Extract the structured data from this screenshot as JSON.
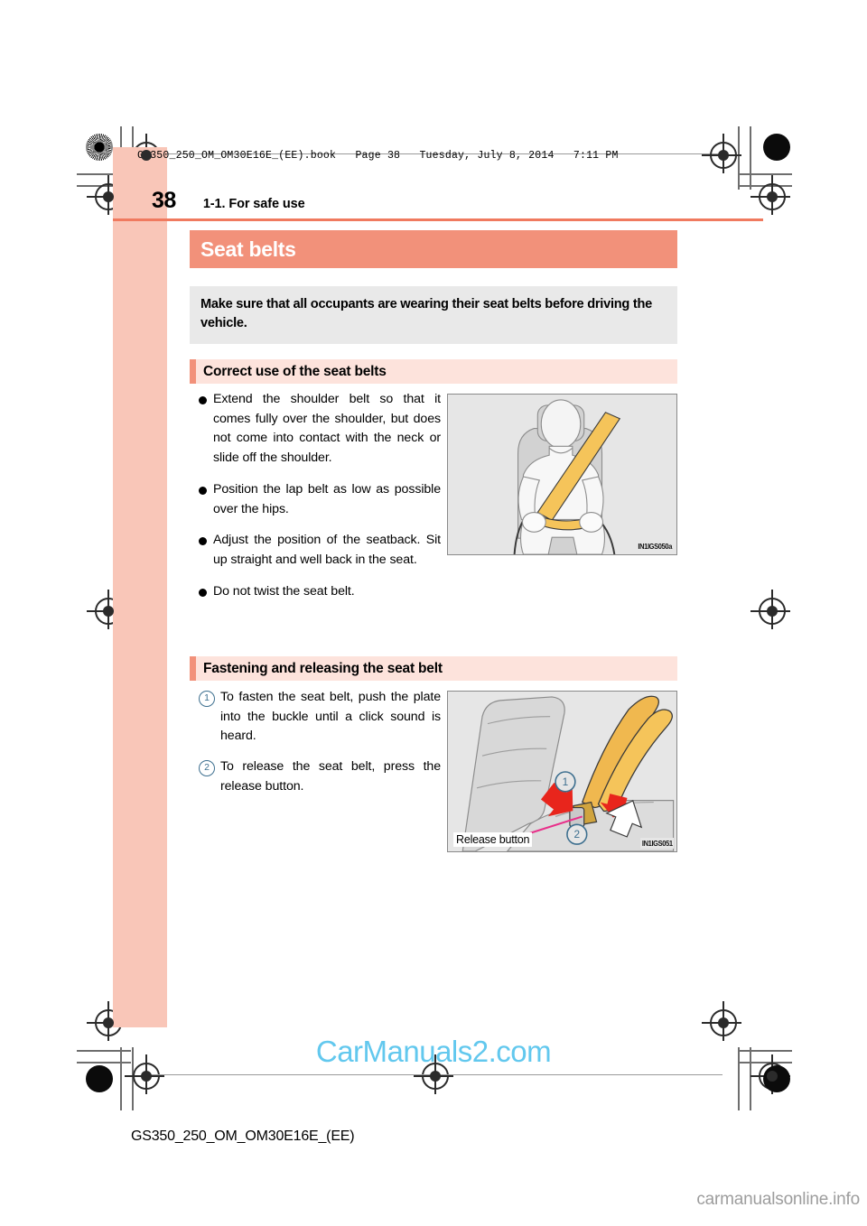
{
  "print_header": {
    "file_line": "GS350_250_OM_OM30E16E_(EE).book   Page 38   Tuesday, July 8, 2014   7:11 PM"
  },
  "page": {
    "number": "38",
    "breadcrumb": "1-1. For safe use",
    "title": "Seat belts",
    "intro": "Make sure that all occupants are wearing their seat belts before driving the vehicle."
  },
  "sections": [
    {
      "heading": "Correct use of the seat belts",
      "bullets": [
        "Extend the shoulder belt so that it comes fully over the shoulder, but does not come into contact with the neck or slide off the shoulder.",
        "Position the lap belt as low as possible over the hips.",
        "Adjust the position of the seatback. Sit up straight and well back in the seat.",
        "Do not twist the seat belt."
      ],
      "figure": {
        "code": "IN1IGS050a",
        "alt": "Occupant seated with shoulder belt across chest and lap belt over hips"
      }
    },
    {
      "heading": "Fastening and releasing the seat belt",
      "steps": [
        {
          "number": "1",
          "text": "To fasten the seat belt, push the plate into the buckle until a click sound is heard."
        },
        {
          "number": "2",
          "text": "To release the seat belt, press the release button."
        }
      ],
      "figure": {
        "code": "IN1IGS051",
        "callout": "Release button",
        "marker_1": "1",
        "marker_2": "2",
        "alt": "Seat with belt plate, buckle and release button"
      }
    }
  ],
  "footer": {
    "document_code": "GS350_250_OM_OM30E16E_(EE)",
    "watermark_center": "CarManuals2.com",
    "watermark_bottom_right": "carmanualsonline.info"
  },
  "colors": {
    "accent_salmon": "#f2917a",
    "accent_light_pink": "#fde3dc",
    "side_tab_pink": "#f9c6b8",
    "intro_gray": "#e9e9e9",
    "rule_orange": "#f07a5f",
    "belt_yellow": "#f5c45a",
    "marker_blue": "#3d6f8f",
    "pointer_pink": "#e8308a",
    "arrow_red": "#e8251c",
    "watermark_blue": "#62c8ee",
    "watermark_gray": "#9d9d9d"
  }
}
